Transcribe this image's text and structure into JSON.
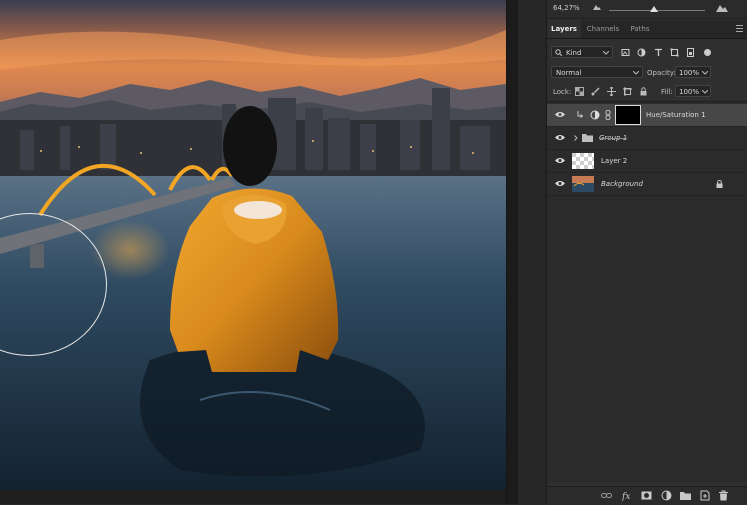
{
  "navigator": {
    "zoom": "64,27%"
  },
  "panel_tabs": {
    "layers": "Layers",
    "channels": "Channels",
    "paths": "Paths"
  },
  "filter": {
    "kind": "Kind"
  },
  "blend": {
    "mode": "Normal",
    "opacity_label": "Opacity:",
    "opacity_value": "100%"
  },
  "lock": {
    "label": "Lock:",
    "fill_label": "Fill:",
    "fill_value": "100%"
  },
  "layers": [
    {
      "name": "Hue/Saturation 1"
    },
    {
      "name": "Group 1"
    },
    {
      "name": "Layer 2"
    },
    {
      "name": "Background"
    }
  ],
  "footer_icons": [
    "link-icon",
    "fx-icon",
    "mask-icon",
    "adjustment-icon",
    "folder-icon",
    "new-layer-icon",
    "trash-icon"
  ],
  "colors": {
    "selected_layer": "#474747",
    "panel_bg": "#2f2f2f"
  }
}
